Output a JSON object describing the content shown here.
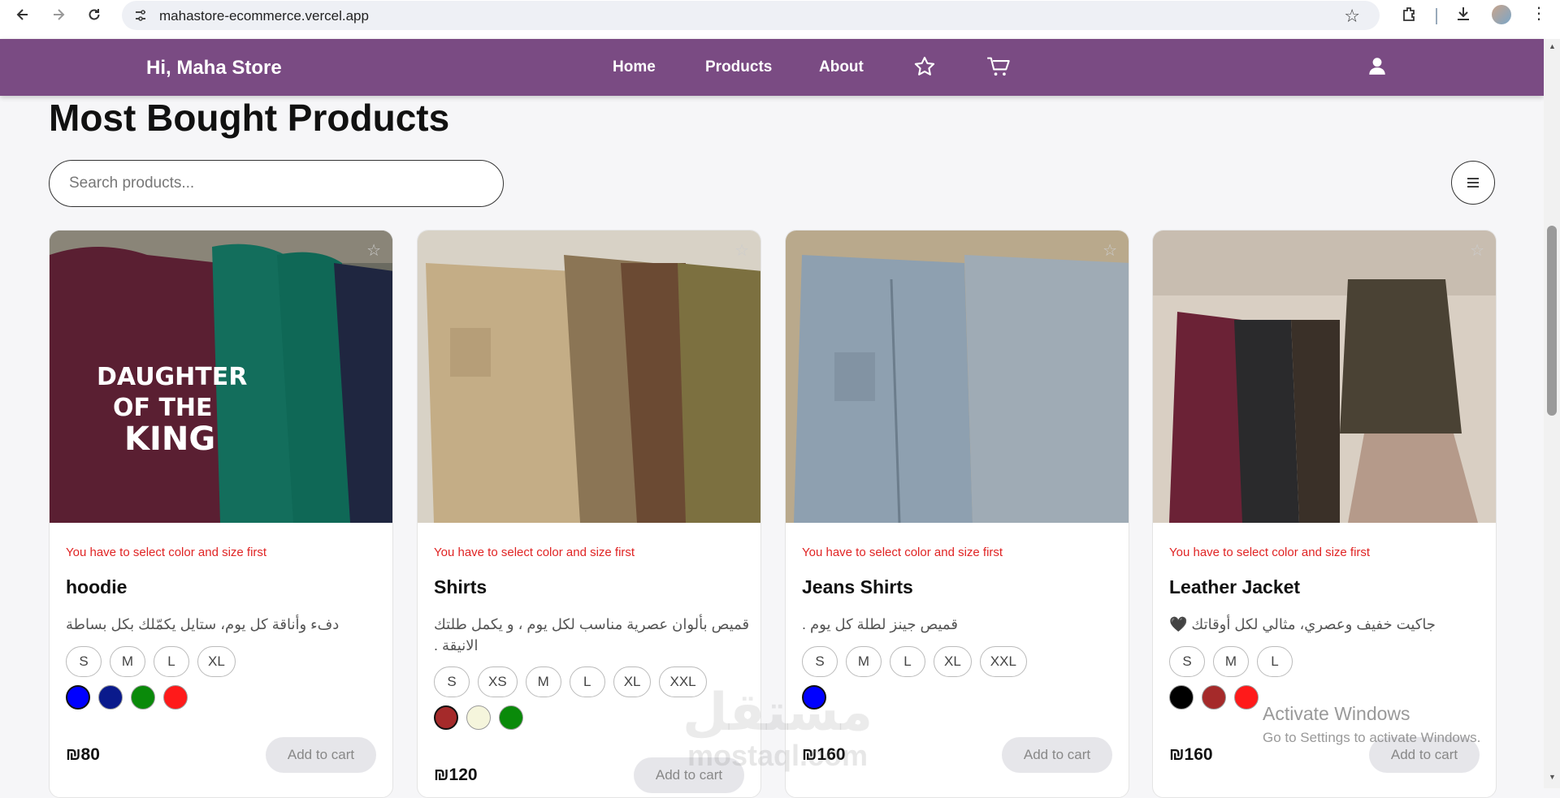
{
  "browser": {
    "url": "mahastore-ecommerce.vercel.app",
    "icons": [
      "back-icon",
      "forward-icon",
      "reload-icon",
      "site-info-icon",
      "bookmark-star-icon",
      "extensions-icon",
      "download-icon",
      "profile-avatar",
      "more-menu-icon"
    ]
  },
  "navbar": {
    "brand": "Hi, Maha Store",
    "links": [
      "Home",
      "Products",
      "About"
    ],
    "icons": [
      "favorites-star-icon",
      "cart-icon",
      "user-icon"
    ],
    "background": "#7a4b83"
  },
  "main": {
    "title": "Most Bought Products",
    "search_placeholder": "Search products...",
    "filter_icon": "menu-icon"
  },
  "products": [
    {
      "warning": "You have to select color and size first",
      "name": "hoodie",
      "description": "دفء وأناقة كل يوم، ستايل يكمّلك بكل بساطة",
      "sizes": [
        "S",
        "M",
        "L",
        "XL"
      ],
      "colors": [
        "#0000ff",
        "#0a1a8c",
        "#0a8a0a",
        "#ff1a1a"
      ],
      "selected_color": 0,
      "price": "₪80",
      "button": "Add to cart"
    },
    {
      "warning": "You have to select color and size first",
      "name": "Shirts",
      "description": "قميص بألوان عصرية مناسب لكل يوم ، و يكمل طلتك الانيقة .",
      "sizes": [
        "S",
        "XS",
        "M",
        "L",
        "XL",
        "XXL"
      ],
      "colors": [
        "#a52a2a",
        "#f5f5dc",
        "#0a8a0a"
      ],
      "selected_color": 0,
      "price": "₪120",
      "button": "Add to cart"
    },
    {
      "warning": "You have to select color and size first",
      "name": "Jeans Shirts",
      "description": "قميص جينز لطلة كل يوم .",
      "sizes": [
        "S",
        "M",
        "L",
        "XL",
        "XXL"
      ],
      "colors": [
        "#0000ff"
      ],
      "selected_color": 0,
      "price": "₪160",
      "button": "Add to cart"
    },
    {
      "warning": "You have to select color and size first",
      "name": "Leather Jacket",
      "description": "جاكيت خفيف وعصري، مثالي لكل أوقاتك 🖤",
      "sizes": [
        "S",
        "M",
        "L"
      ],
      "colors": [
        "#000000",
        "#a52a2a",
        "#ff1a1a"
      ],
      "selected_color": -1,
      "price": "₪160",
      "button": "Add to cart"
    }
  ],
  "overlay": {
    "watermark_ar": "مستقل",
    "watermark_en": "mostaql.com",
    "activate_title": "Activate Windows",
    "activate_sub": "Go to Settings to activate Windows."
  }
}
